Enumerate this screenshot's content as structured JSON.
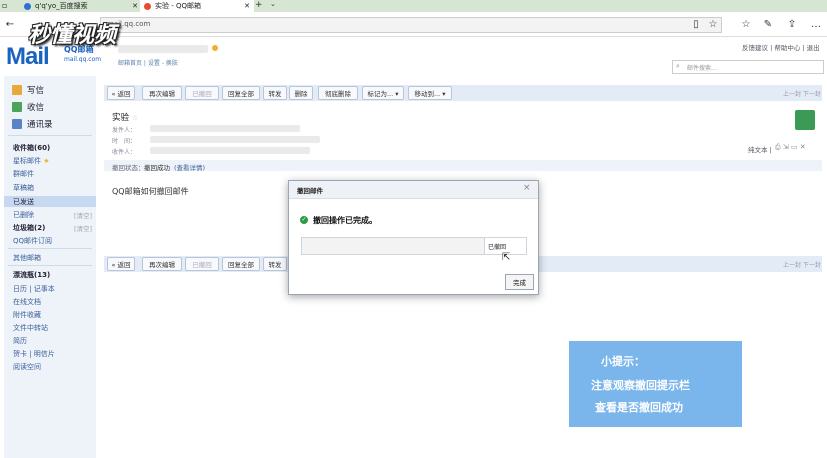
{
  "browser": {
    "tabs": [
      {
        "title": "q'q'yo_百度搜索",
        "icon_color": "#2f6fdc"
      },
      {
        "title": "实验 - QQ邮箱",
        "icon_color": "#e64b2e"
      }
    ],
    "url": "mail.qq.com"
  },
  "watermark": "秒懂视频",
  "mail_header": {
    "logo": "Mail",
    "logo_qq": "QQ邮箱",
    "domain": "mail.qq.com",
    "links": "邮箱首页 | 设置 - 换肤",
    "top_links": "反馈建议 | 帮助中心 | 退出",
    "search_placeholder": "邮件搜索..."
  },
  "sidebar": {
    "write": "写信",
    "receive": "收信",
    "contacts": "通讯录",
    "folders": [
      {
        "label": "收件箱(60)"
      },
      {
        "label": "星标邮件"
      },
      {
        "label": "群邮件"
      },
      {
        "label": "草稿箱"
      },
      {
        "label": "已发送"
      },
      {
        "label": "已删除",
        "clear": "[清空]"
      },
      {
        "label": "垃圾箱(2)",
        "clear": "[清空]"
      },
      {
        "label": "QQ邮件订阅"
      },
      {
        "label": "其他邮箱"
      },
      {
        "label": "漂流瓶(13)"
      },
      {
        "label": "日历 | 记事本"
      },
      {
        "label": "在线文档"
      },
      {
        "label": "附件收藏"
      },
      {
        "label": "文件中转站"
      },
      {
        "label": "简历"
      },
      {
        "label": "贺卡 | 明信片"
      },
      {
        "label": "阅读空间"
      }
    ]
  },
  "toolbar": {
    "buttons": [
      "« 返回",
      "再次编辑",
      "已撤回",
      "回复全部",
      "转发",
      "删除",
      "彻底删除",
      "标记为... ▾",
      "移动到... ▾"
    ],
    "pager": "上一封 下一封"
  },
  "email": {
    "subject": "实验",
    "from_label": "发件人：",
    "time_label": "时　间：",
    "to_label": "收件人：",
    "plain_text": "纯文本 | ",
    "recall_status_label": "撤回状态：",
    "recall_status_value": "撤回成功",
    "recall_details": "(查看详情)",
    "body": "QQ邮箱如何撤回邮件"
  },
  "modal": {
    "title": "撤回邮件",
    "message": "撤回操作已完成。",
    "recipient_status": "已撤回",
    "done_button": "完成"
  },
  "tip": {
    "title": "小提示：",
    "line1": "注意观察撤回提示栏",
    "line2": "查看是否撤回成功"
  }
}
